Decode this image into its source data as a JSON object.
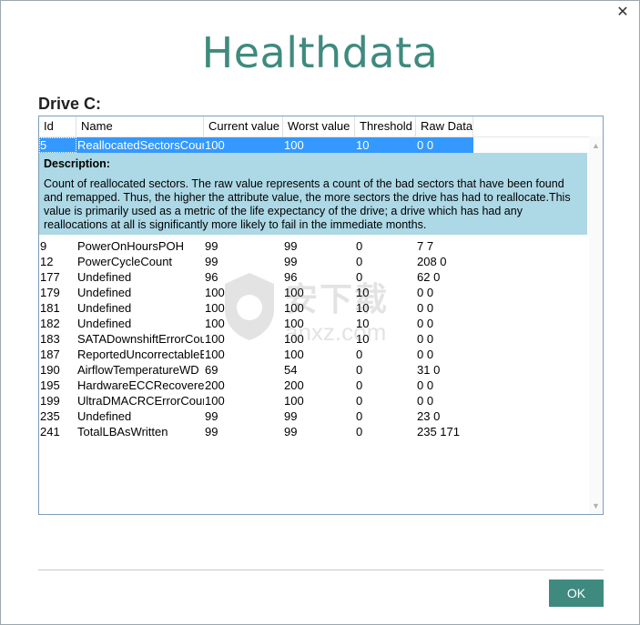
{
  "window": {
    "close_glyph": "✕"
  },
  "app": {
    "title": "Healthdata"
  },
  "drive": {
    "label": "Drive C:"
  },
  "table": {
    "headers": [
      "Id",
      "Name",
      "Current value",
      "Worst value",
      "Threshold",
      "Raw Data"
    ],
    "selected_row": [
      "5",
      "ReallocatedSectorsCoun",
      "100",
      "100",
      "10",
      "0 0"
    ],
    "description": {
      "title": "Description:",
      "body": "Count of reallocated sectors. The raw value represents a count of the bad sectors that have been found and remapped. Thus, the higher the attribute value, the more sectors the drive has had to reallocate.This value is primarily used as a metric of the life expectancy of the drive; a drive which has had any reallocations at all is significantly more likely to fail in the immediate months."
    },
    "rows": [
      [
        "9",
        "PowerOnHoursPOH",
        "99",
        "99",
        "0",
        "7 7"
      ],
      [
        "12",
        "PowerCycleCount",
        "99",
        "99",
        "0",
        "208 0"
      ],
      [
        "177",
        "Undefined",
        "96",
        "96",
        "0",
        "62 0"
      ],
      [
        "179",
        "Undefined",
        "100",
        "100",
        "10",
        "0 0"
      ],
      [
        "181",
        "Undefined",
        "100",
        "100",
        "10",
        "0 0"
      ],
      [
        "182",
        "Undefined",
        "100",
        "100",
        "10",
        "0 0"
      ],
      [
        "183",
        "SATADownshiftErrorCou",
        "100",
        "100",
        "10",
        "0 0"
      ],
      [
        "187",
        "ReportedUncorrectableE",
        "100",
        "100",
        "0",
        "0 0"
      ],
      [
        "190",
        "AirflowTemperatureWD",
        "69",
        "54",
        "0",
        "31 0"
      ],
      [
        "195",
        "HardwareECCRecovered",
        "200",
        "200",
        "0",
        "0 0"
      ],
      [
        "199",
        "UltraDMACRCErrorCoun",
        "100",
        "100",
        "0",
        "0 0"
      ],
      [
        "235",
        "Undefined",
        "99",
        "99",
        "0",
        "23 0"
      ],
      [
        "241",
        "TotalLBAsWritten",
        "99",
        "99",
        "0",
        "235 171"
      ]
    ]
  },
  "watermark": {
    "text": "安下载",
    "sub": "anxz.com"
  },
  "buttons": {
    "ok": "OK"
  },
  "colors": {
    "accent": "#3f8a7e",
    "selection": "#3399ff",
    "description_bg": "#add8e6"
  }
}
